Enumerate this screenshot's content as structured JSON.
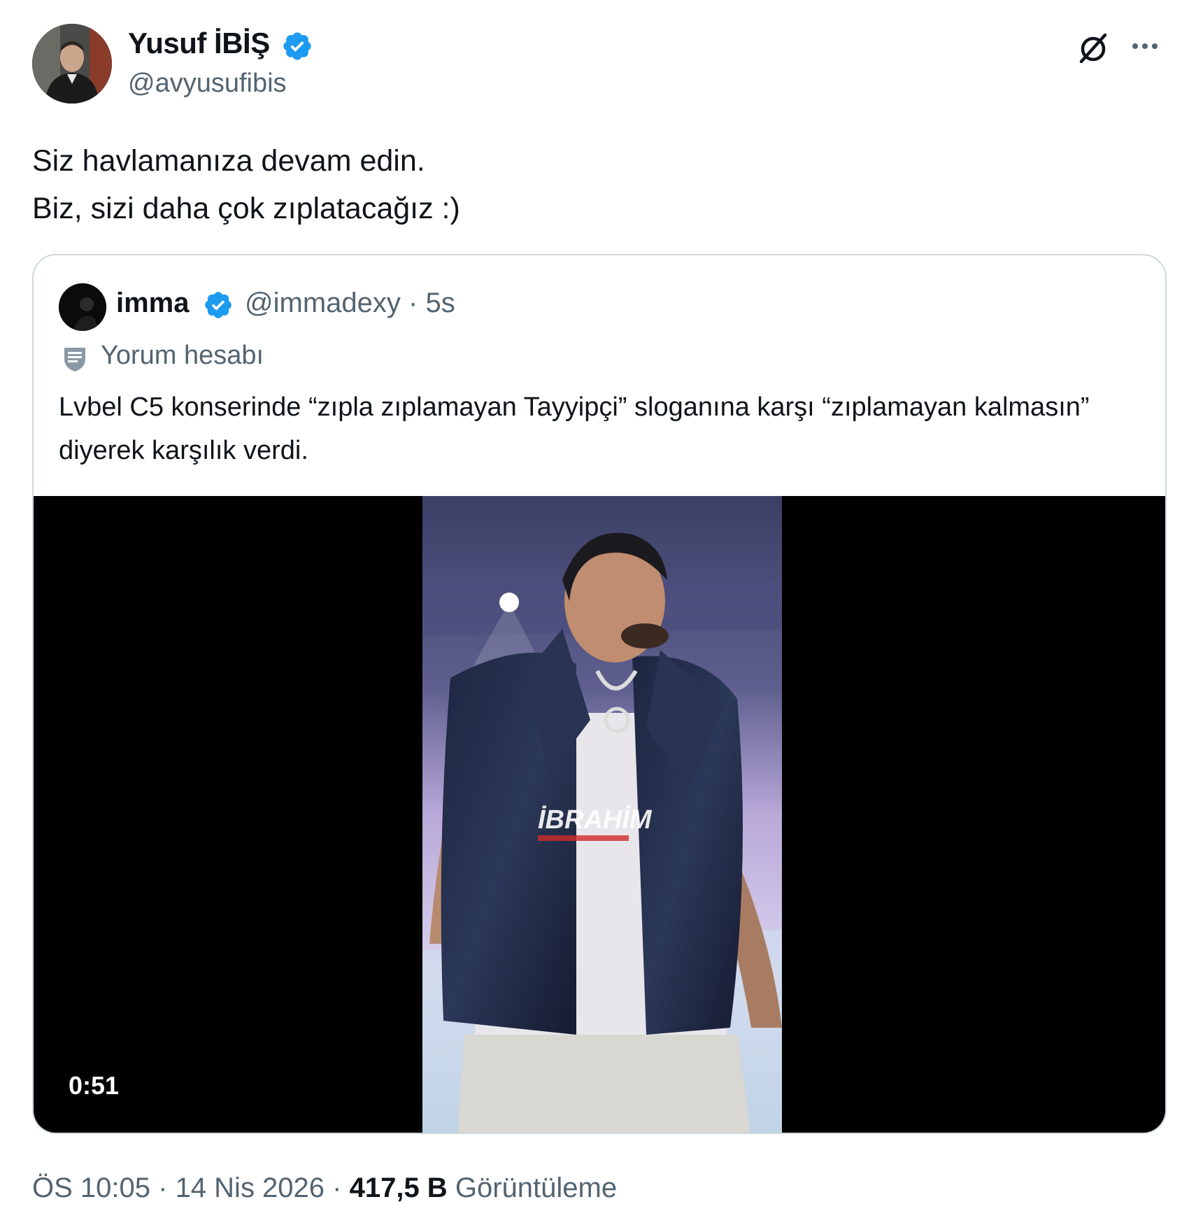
{
  "tweet": {
    "author": {
      "name": "Yusuf İBİŞ",
      "handle": "@avyusufibis",
      "verified": true,
      "badge_color": "#1d9bf0"
    },
    "actions": {
      "grok_icon": "grok-icon",
      "more_icon": "more-icon"
    },
    "text_lines": [
      "Siz havlamanıza devam edin.",
      "Biz, sizi daha çok zıplatacağız :)"
    ],
    "quote": {
      "name": "imma",
      "handle": "@immadexy",
      "separator": "·",
      "time": "5s",
      "verified": true,
      "label_icon": "shield-comment-icon",
      "label": "Yorum hesabı",
      "text": "Lvbel C5 konserinde “zıpla zıplamayan Tayyipçi” sloganına karşı “zıplamayan kalmasın” diyerek karşılık verdi.",
      "video": {
        "duration": "0:51",
        "watermark": "İBRAHİM"
      }
    },
    "footer": {
      "time": "ÖS 10:05",
      "sep1": " · ",
      "date": "14 Nis 2026",
      "sep2": " · ",
      "views_count": "417,5 B",
      "views_label": "Görüntüleme"
    }
  },
  "colors": {
    "text": "#0f1419",
    "secondary": "#536471",
    "border": "#cfd9de",
    "brand": "#1d9bf0"
  }
}
